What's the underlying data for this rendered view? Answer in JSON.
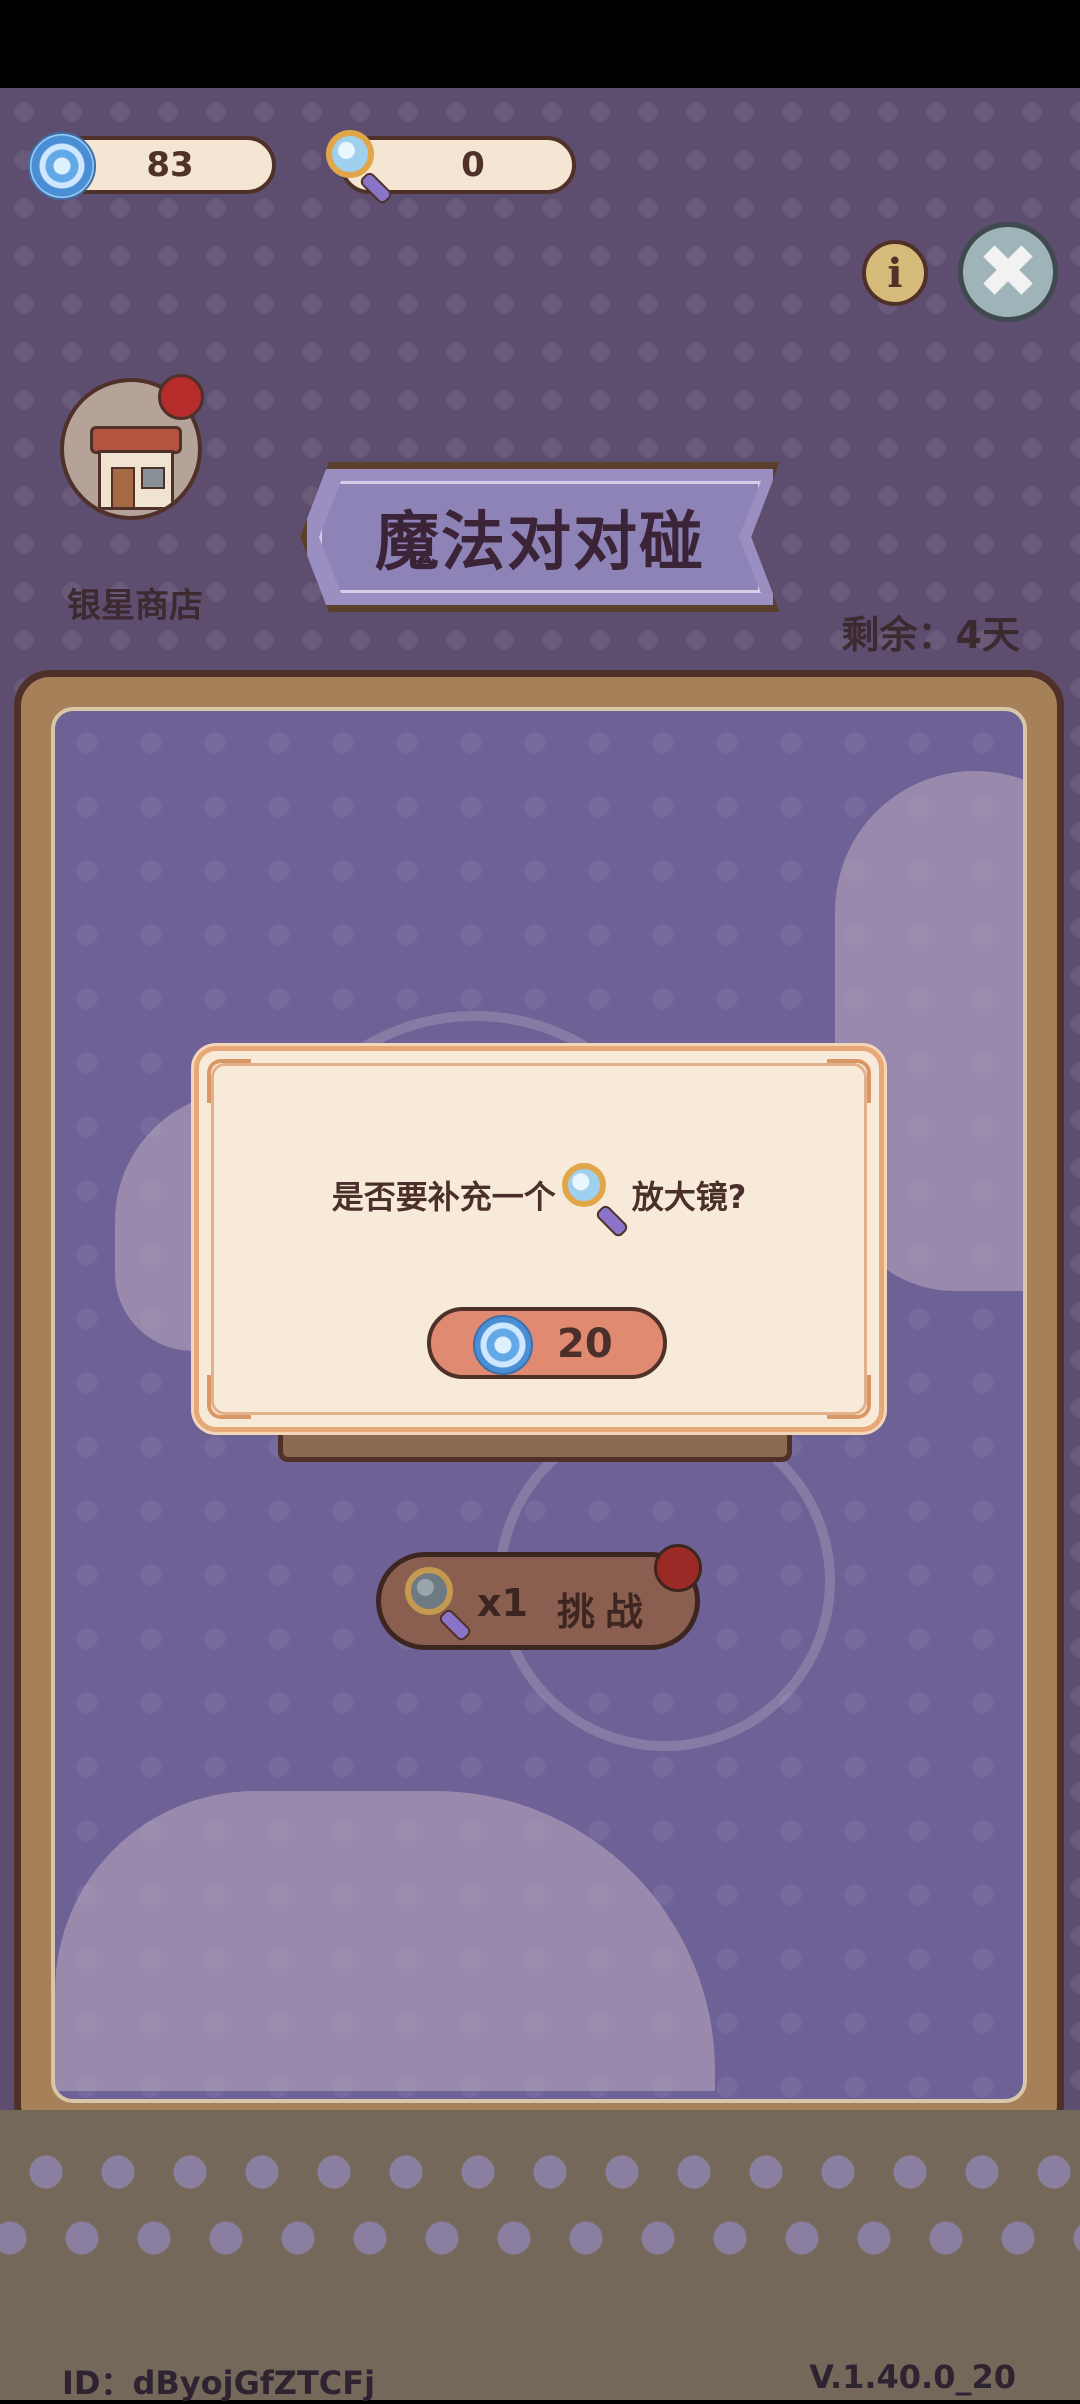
{
  "currency": {
    "gems": "83",
    "magnifiers": "0"
  },
  "shop": {
    "label": "银星商店"
  },
  "title": "魔法对对碰",
  "remaining": "剩余：4天",
  "info_glyph": "i",
  "close_glyph": "✖",
  "dialog": {
    "message_before": "是否要补充一个",
    "message_after": "放大镜?",
    "price": "20"
  },
  "challenge": {
    "count": "x1",
    "label": "挑战"
  },
  "footer": {
    "id": "ID：dByojGfZTCFj",
    "version": "V.1.40.0_20"
  },
  "colors": {
    "accent": "#e08a72",
    "frame": "#4f3129",
    "background": "#6c5e82"
  },
  "icons": [
    "swirl-gem-icon",
    "magnifier-icon",
    "info-icon",
    "close-icon",
    "shop-icon",
    "badge-dot"
  ]
}
